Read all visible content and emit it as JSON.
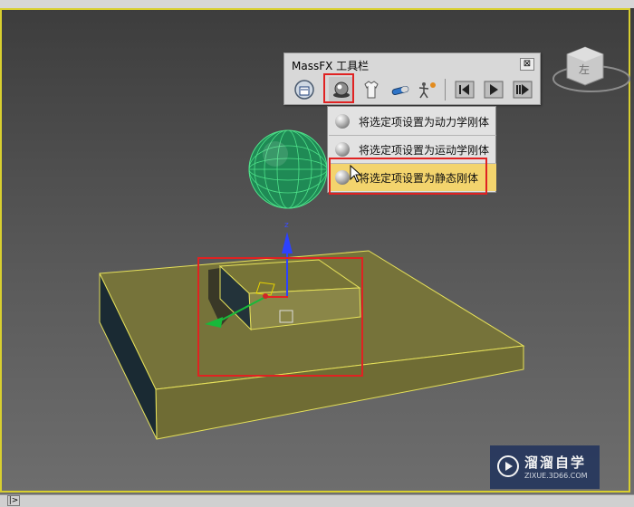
{
  "toolbar": {
    "title": "MassFX 工具栏",
    "close_glyph": "⊠",
    "buttons": [
      {
        "name": "world-parameters-icon"
      },
      {
        "name": "rigid-body-icon",
        "highlighted": true
      },
      {
        "name": "cloth-icon"
      },
      {
        "name": "constraint-icon"
      },
      {
        "name": "ragdoll-icon"
      },
      {
        "name": "reset-simulation-icon"
      },
      {
        "name": "play-simulation-icon"
      },
      {
        "name": "step-simulation-icon"
      }
    ]
  },
  "rigid_body_menu": {
    "items": [
      {
        "label": "将选定项设置为动力学刚体",
        "active": false
      },
      {
        "label": "将选定项设置为运动学刚体",
        "active": false
      },
      {
        "label": "将选定项设置为静态刚体",
        "active": true
      }
    ]
  },
  "viewport": {
    "gizmo_axis_label": "z",
    "viewcube_label": "左"
  },
  "watermark": {
    "title": "溜溜自学",
    "url": "ZIXUE.3D66.COM"
  },
  "bottom_bar": {
    "arrow": "|>"
  },
  "colors": {
    "menu_highlight": "#f3d46d",
    "selection_red": "#e02222",
    "viewport_border": "#d8cf2f",
    "object_olive": "#7d7a3a"
  }
}
